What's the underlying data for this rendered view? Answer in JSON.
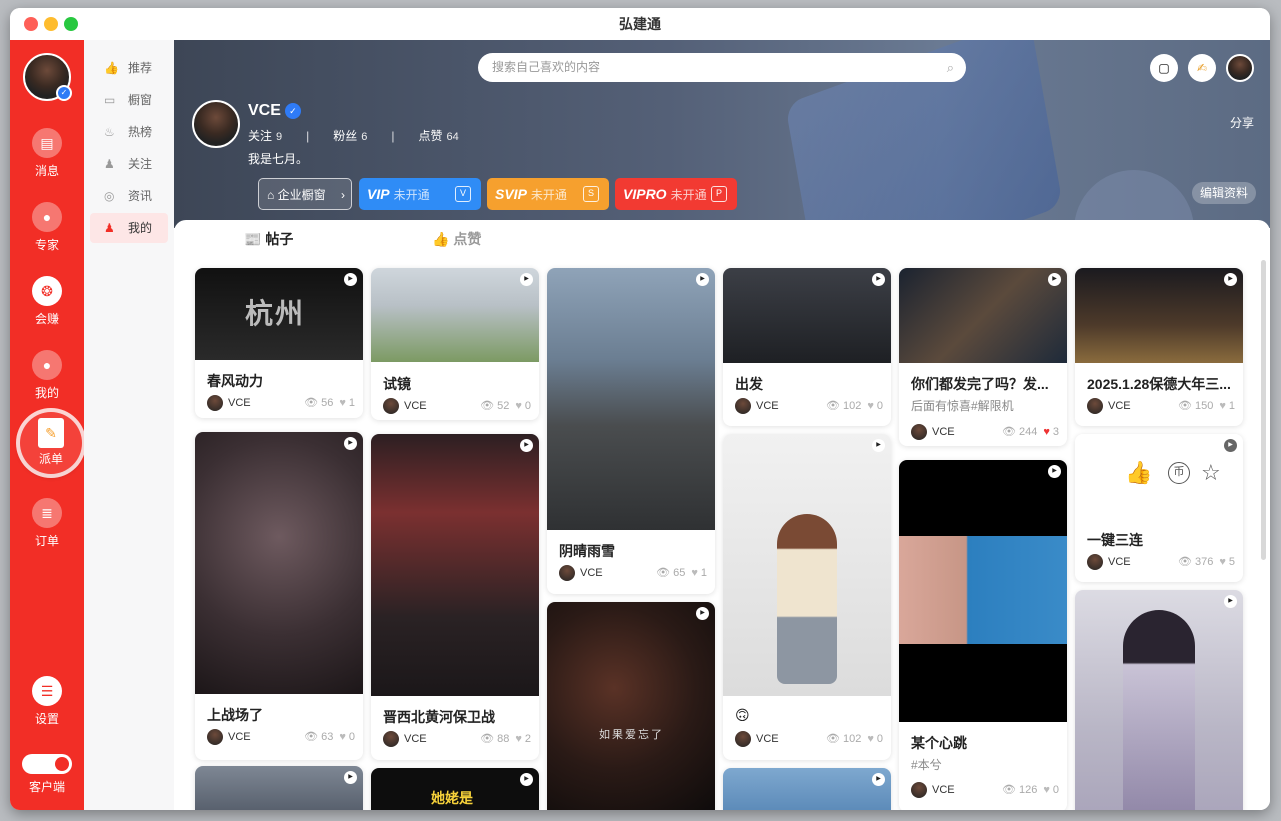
{
  "window": {
    "title": "弘建通"
  },
  "rail": {
    "items": [
      {
        "label": "消息",
        "icon": "message-icon"
      },
      {
        "label": "专家",
        "icon": "expert-icon"
      },
      {
        "label": "会赚",
        "icon": "earn-icon"
      },
      {
        "label": "我的",
        "icon": "user-icon"
      },
      {
        "label": "派单",
        "icon": "dispatch-icon"
      },
      {
        "label": "订单",
        "icon": "order-icon"
      },
      {
        "label": "设置",
        "icon": "settings-icon"
      }
    ],
    "client_label": "客户端"
  },
  "subnav": {
    "items": [
      {
        "label": "推荐",
        "icon": "thumbs-up-icon"
      },
      {
        "label": "橱窗",
        "icon": "shop-icon"
      },
      {
        "label": "热榜",
        "icon": "flame-icon"
      },
      {
        "label": "关注",
        "icon": "follow-icon"
      },
      {
        "label": "资讯",
        "icon": "news-icon"
      },
      {
        "label": "我的",
        "icon": "user-icon",
        "active": true
      }
    ]
  },
  "header": {
    "search_placeholder": "搜索自己喜欢的内容"
  },
  "profile": {
    "name": "VCE",
    "follow_label": "关注",
    "follow_count": "9",
    "fans_label": "粉丝",
    "fans_count": "6",
    "likes_label": "点赞",
    "likes_count": "64",
    "motto": "我是七月。",
    "share": "分享",
    "edit": "编辑资料",
    "shop_button": "企业橱窗",
    "vip": [
      {
        "name": "VIP",
        "status": "未开通",
        "color": "#2f8cf6"
      },
      {
        "name": "SVIP",
        "status": "未开通",
        "color": "#f6a02e"
      },
      {
        "name": "VIPRO",
        "status": "未开通",
        "color": "#f23a32"
      }
    ]
  },
  "tabs": [
    {
      "label": "帖子",
      "icon": "📰",
      "active": true
    },
    {
      "label": "点赞",
      "icon": "👍",
      "active": false
    }
  ],
  "posts": [
    {
      "title": "春风动力",
      "author": "VCE",
      "views": "56",
      "likes": "1",
      "thumb_text": "杭州"
    },
    {
      "title": "试镜",
      "author": "VCE",
      "views": "52",
      "likes": "0"
    },
    {
      "title": "阴晴雨雪",
      "author": "VCE",
      "views": "65",
      "likes": "1"
    },
    {
      "title": "出发",
      "author": "VCE",
      "views": "102",
      "likes": "0"
    },
    {
      "title": "你们都发完了吗？发...",
      "subtitle": "后面有惊喜#解限机",
      "author": "VCE",
      "views": "244",
      "likes": "3",
      "liked": true
    },
    {
      "title": "2025.1.28保德大年三...",
      "author": "VCE",
      "views": "150",
      "likes": "1"
    },
    {
      "title": "上战场了",
      "author": "VCE",
      "views": "63",
      "likes": "0"
    },
    {
      "title": "晋西北黄河保卫战",
      "author": "VCE",
      "views": "88",
      "likes": "2"
    },
    {
      "title": "🙃",
      "author": "VCE",
      "views": "102",
      "likes": "0"
    },
    {
      "title": "某个心跳",
      "subtitle": "#本兮",
      "author": "VCE",
      "views": "126",
      "likes": "0"
    },
    {
      "title": "一键三连",
      "author": "VCE",
      "views": "376",
      "likes": "5"
    },
    {
      "title": "",
      "thumb_text": "她姥是"
    },
    {
      "title": "",
      "thumb_text": "如果爱忘了"
    }
  ]
}
